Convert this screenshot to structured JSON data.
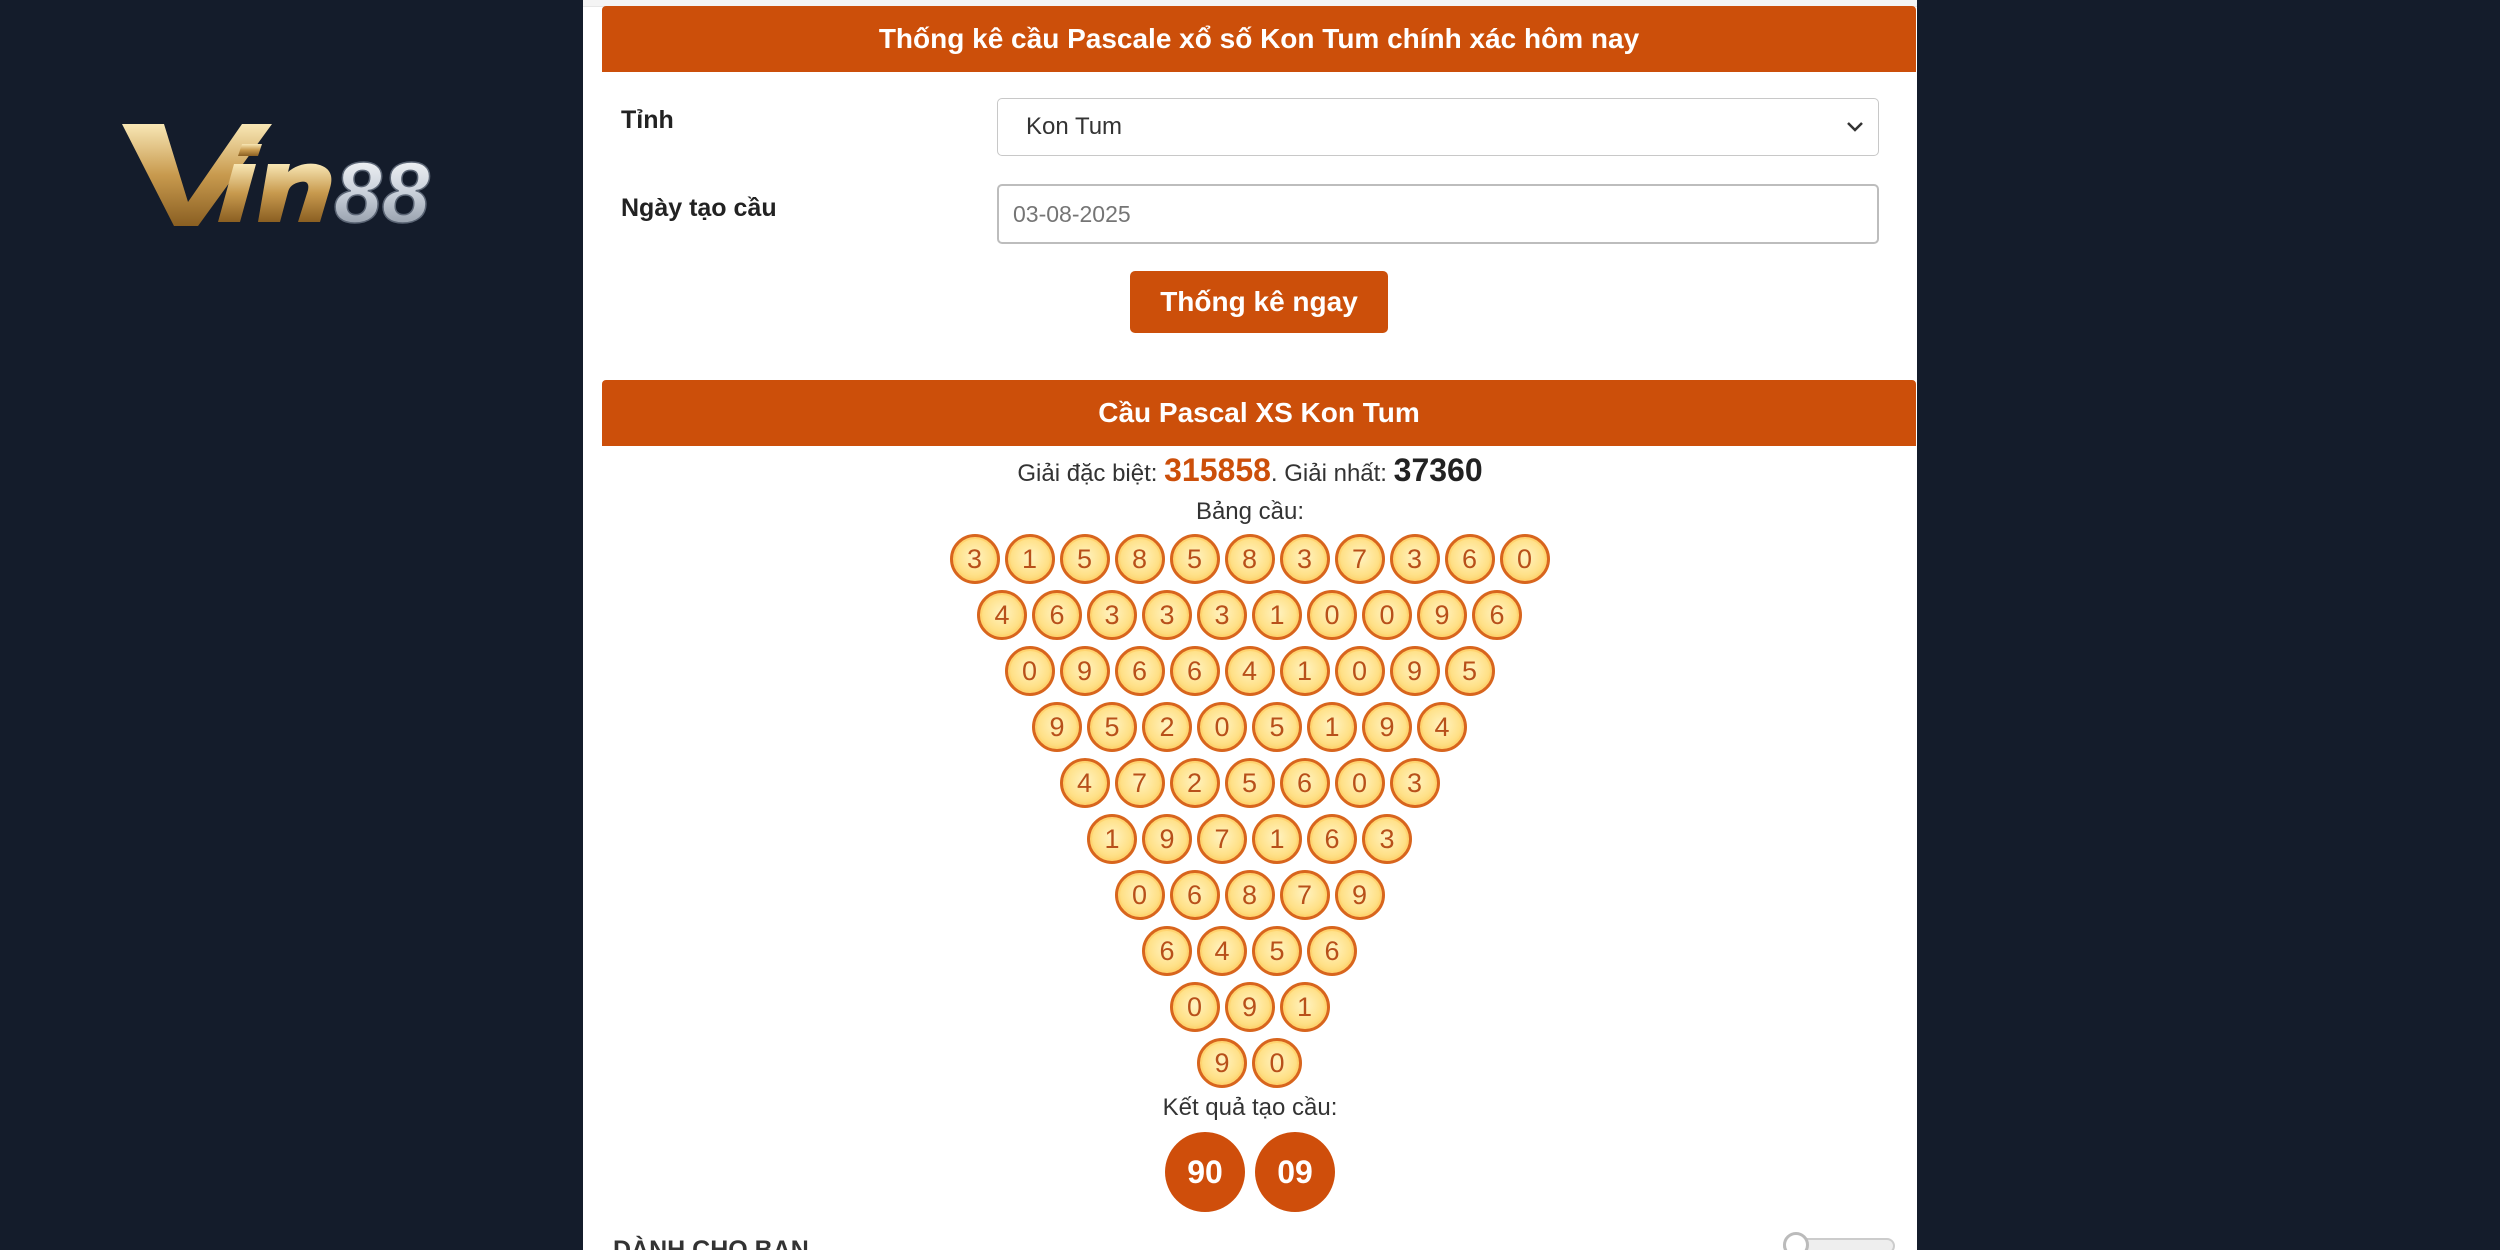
{
  "brand": {
    "logo_text": "Vin88",
    "colors": {
      "page_bg": "#141c2b",
      "accent": "#cc4f0a",
      "ball_border": "#d8651d",
      "ball_fill": "#ffe189"
    }
  },
  "form": {
    "title": "Thống kê cầu Pascale xổ số Kon Tum chính xác hôm nay",
    "province_label": "Tỉnh",
    "province_value": "Kon Tum",
    "date_label": "Ngày tạo cầu",
    "date_placeholder": "03-08-2025",
    "submit_label": "Thống kê ngay"
  },
  "result_section": {
    "title": "Cầu Pascal XS Kon Tum",
    "special_label": "Giải đặc biệt: ",
    "special_value": "315858",
    "first_label": ". Giải nhất: ",
    "first_value": "37360",
    "table_caption": "Bảng cầu:",
    "rows": [
      [
        "3",
        "1",
        "5",
        "8",
        "5",
        "8",
        "3",
        "7",
        "3",
        "6",
        "0"
      ],
      [
        "4",
        "6",
        "3",
        "3",
        "3",
        "1",
        "0",
        "0",
        "9",
        "6"
      ],
      [
        "0",
        "9",
        "6",
        "6",
        "4",
        "1",
        "0",
        "9",
        "5"
      ],
      [
        "9",
        "5",
        "2",
        "0",
        "5",
        "1",
        "9",
        "4"
      ],
      [
        "4",
        "7",
        "2",
        "5",
        "6",
        "0",
        "3"
      ],
      [
        "1",
        "9",
        "7",
        "1",
        "6",
        "3"
      ],
      [
        "0",
        "6",
        "8",
        "7",
        "9"
      ],
      [
        "6",
        "4",
        "5",
        "6"
      ],
      [
        "0",
        "9",
        "1"
      ],
      [
        "9",
        "0"
      ]
    ],
    "result_caption": "Kết quả tạo cầu:",
    "results": [
      "90",
      "09"
    ]
  },
  "footer": {
    "title": "DÀNH CHO BẠN"
  },
  "icons": {
    "select_arrow": "chevron-down-icon"
  }
}
